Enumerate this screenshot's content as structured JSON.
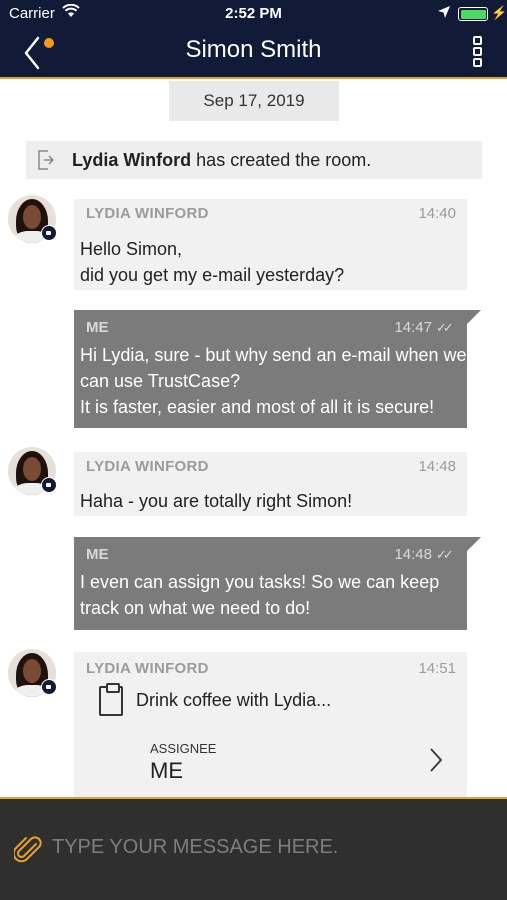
{
  "status_bar": {
    "carrier": "Carrier",
    "time": "2:52 PM"
  },
  "header": {
    "title": "Simon Smith",
    "back_icon": "chevron-left-icon",
    "menu_icon": "more-vertical-icon"
  },
  "date_chip": "Sep 17, 2019",
  "system_message": {
    "name": "Lydia Winford",
    "text": " has created the room."
  },
  "messages": [
    {
      "sender": "LYDIA WINFORD",
      "time": "14:40",
      "lines": [
        "Hello Simon,",
        "did you get my e-mail yesterday?"
      ]
    },
    {
      "sender": "ME",
      "time": "14:47",
      "lines": [
        "Hi Lydia, sure - but why send an e-mail when we",
        "can use TrustCase?",
        "It is faster, easier and most of all it is secure!"
      ]
    },
    {
      "sender": "LYDIA WINFORD",
      "time": "14:48",
      "lines": [
        "Haha - you are totally right Simon!"
      ]
    },
    {
      "sender": "ME",
      "time": "14:48",
      "lines": [
        "I even can assign you tasks! So we can keep",
        "track on what we need to do!"
      ]
    },
    {
      "sender": "LYDIA WINFORD",
      "time": "14:51",
      "task": {
        "title": "Drink coffee with Lydia...",
        "assignee_label": "ASSIGNEE",
        "assignee": "ME"
      }
    }
  ],
  "composer": {
    "placeholder": "TYPE YOUR MESSAGE HERE."
  },
  "colors": {
    "header_bg": "#111a36",
    "accent": "#e6a12b",
    "outgoing_bubble": "#7b7b7b",
    "incoming_bubble": "#f1f1f1"
  }
}
